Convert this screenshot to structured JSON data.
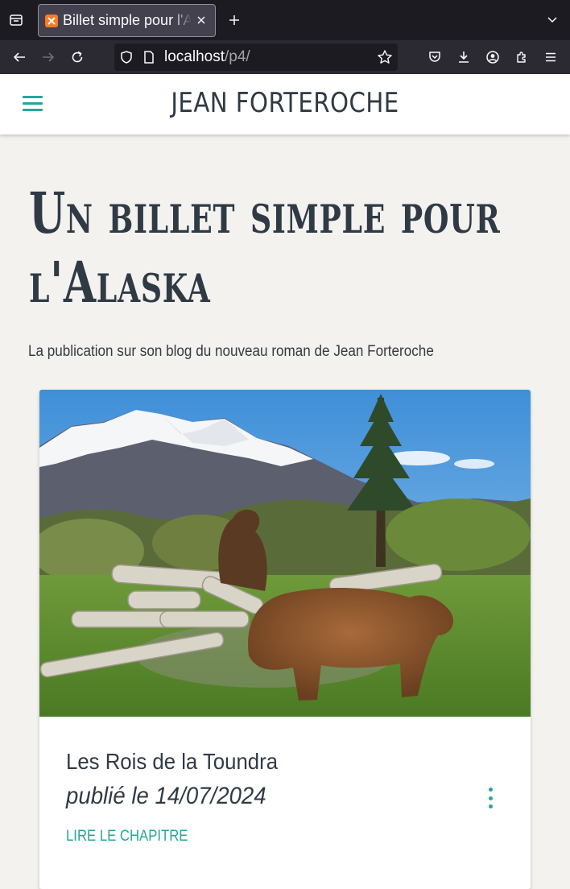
{
  "browser": {
    "tab": {
      "title": "Billet simple pour l'Alaska"
    },
    "url": {
      "host": "localhost",
      "path": "/p4/"
    }
  },
  "site": {
    "brand": "JEAN FORTEROCHE",
    "hero": {
      "title": "Un billet simple pour l'Alaska",
      "subtitle": "La publication sur son blog du nouveau roman de Jean Forteroche"
    },
    "chapter_card": {
      "title": "Les Rois de la Toundra",
      "date": "publié le 14/07/2024",
      "link": "Lire le chapitre"
    }
  },
  "colors": {
    "accent": "#26a69a",
    "text": "#2f3a45",
    "page_bg": "#f3f2ef",
    "chrome_dark": "#1c1b22",
    "chrome_toolbar": "#2b2a33"
  }
}
